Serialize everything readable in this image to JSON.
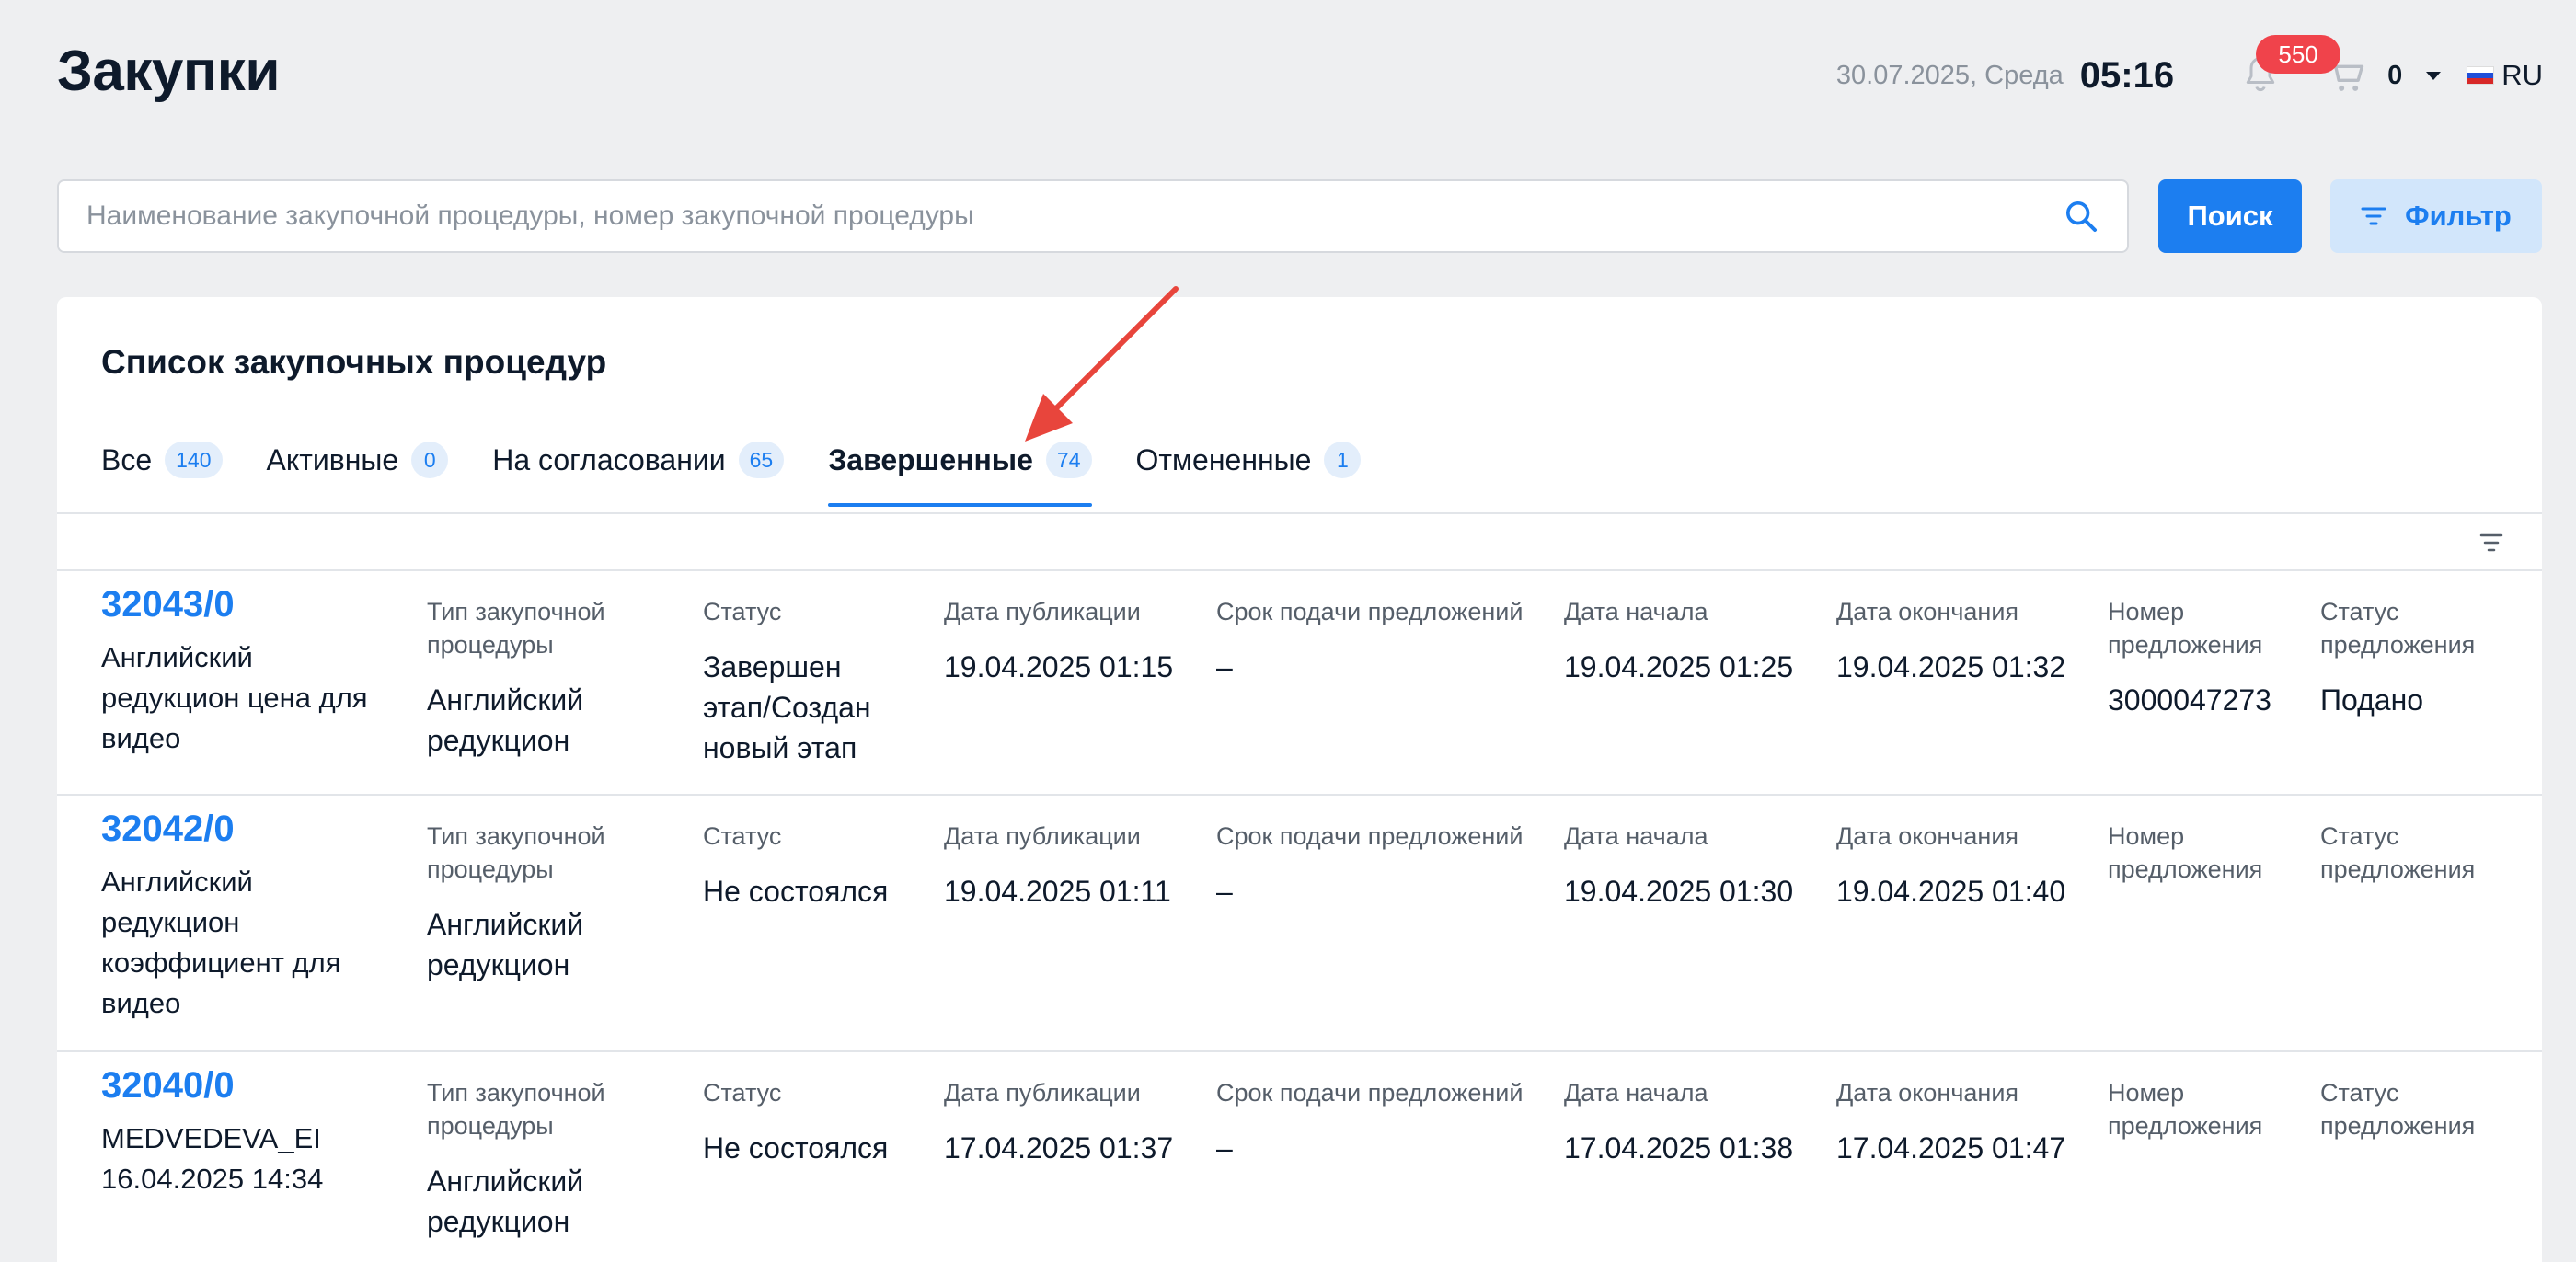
{
  "header": {
    "title": "Закупки",
    "date": "30.07.2025, Среда",
    "time": "05:16",
    "notifications_count": "550",
    "cart_count": "0",
    "language": "RU"
  },
  "search": {
    "placeholder": "Наименование закупочной процедуры, номер закупочной процедуры",
    "value": "",
    "search_button": "Поиск",
    "filter_button": "Фильтр"
  },
  "list": {
    "title": "Список закупочных процедур",
    "tabs": [
      {
        "label": "Все",
        "count": "140"
      },
      {
        "label": "Активные",
        "count": "0"
      },
      {
        "label": "На согласовании",
        "count": "65"
      },
      {
        "label": "Завершенные",
        "count": "74",
        "active": true
      },
      {
        "label": "Отмененные",
        "count": "1"
      }
    ],
    "column_labels": {
      "type": "Тип закупочной процедуры",
      "status": "Статус",
      "published": "Дата публикации",
      "deadline": "Срок подачи предложений",
      "start": "Дата начала",
      "end": "Дата окончания",
      "offer_number": "Номер предложения",
      "offer_status": "Статус предложения"
    },
    "rows": [
      {
        "id": "32043/0",
        "name": "Английский редукцион цена для видео",
        "type": "Английский редукцион",
        "status": "Завершен этап/Создан новый этап",
        "published": "19.04.2025 01:15",
        "deadline": "–",
        "start": "19.04.2025 01:25",
        "end": "19.04.2025 01:32",
        "offer_number": "3000047273",
        "offer_status": "Подано"
      },
      {
        "id": "32042/0",
        "name": "Английский редукцион коэффициент для видео",
        "type": "Английский редукцион",
        "status": "Не состоялся",
        "published": "19.04.2025 01:11",
        "deadline": "–",
        "start": "19.04.2025 01:30",
        "end": "19.04.2025 01:40",
        "offer_number": "",
        "offer_status": ""
      },
      {
        "id": "32040/0",
        "name": "MEDVEDEVA_EI 16.04.2025 14:34",
        "type": "Английский редукцион",
        "status": "Не состоялся",
        "published": "17.04.2025 01:37",
        "deadline": "–",
        "start": "17.04.2025 01:38",
        "end": "17.04.2025 01:47",
        "offer_number": "",
        "offer_status": ""
      }
    ]
  },
  "colors": {
    "accent": "#1c7ef0",
    "badge_red": "#f0434b",
    "annotation_arrow": "#e8453c",
    "background": "#eeeff1"
  }
}
